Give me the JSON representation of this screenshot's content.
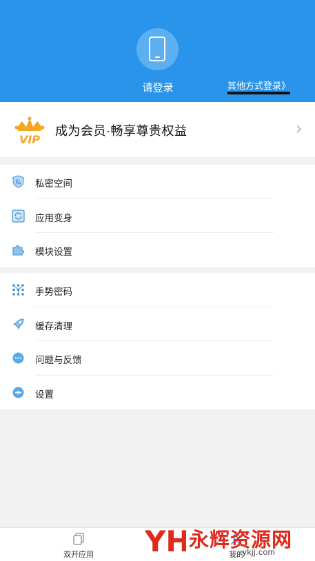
{
  "header": {
    "login_label": "请登录",
    "other_login_label": "其他方式登录》",
    "background_color": "#2a94ea",
    "avatar_icon": "phone-icon"
  },
  "vip": {
    "text": "成为会员·畅享尊贵权益",
    "icon": "vip-crown-icon",
    "chevron": "›",
    "accent_color": "#f5a623"
  },
  "menu_group_1": [
    {
      "label": "私密空间",
      "icon": "shield-icon"
    },
    {
      "label": "应用变身",
      "icon": "app-transform-icon"
    },
    {
      "label": "模块设置",
      "icon": "puzzle-icon"
    }
  ],
  "menu_group_2": [
    {
      "label": "手势密码",
      "icon": "gesture-dots-icon"
    },
    {
      "label": "缓存清理",
      "icon": "rocket-icon"
    },
    {
      "label": "问题与反馈",
      "icon": "feedback-bubble-icon"
    },
    {
      "label": "设置",
      "icon": "settings-icon"
    }
  ],
  "bottom_nav": {
    "tabs": [
      {
        "label": "双开应用",
        "icon": "copy-app-icon"
      },
      {
        "label": "我的",
        "icon": "profile-icon"
      }
    ]
  },
  "watermark": {
    "logo_text": "YH",
    "title": "永辉资源网",
    "url": ".ykjj.com",
    "color": "#e02a1d"
  }
}
